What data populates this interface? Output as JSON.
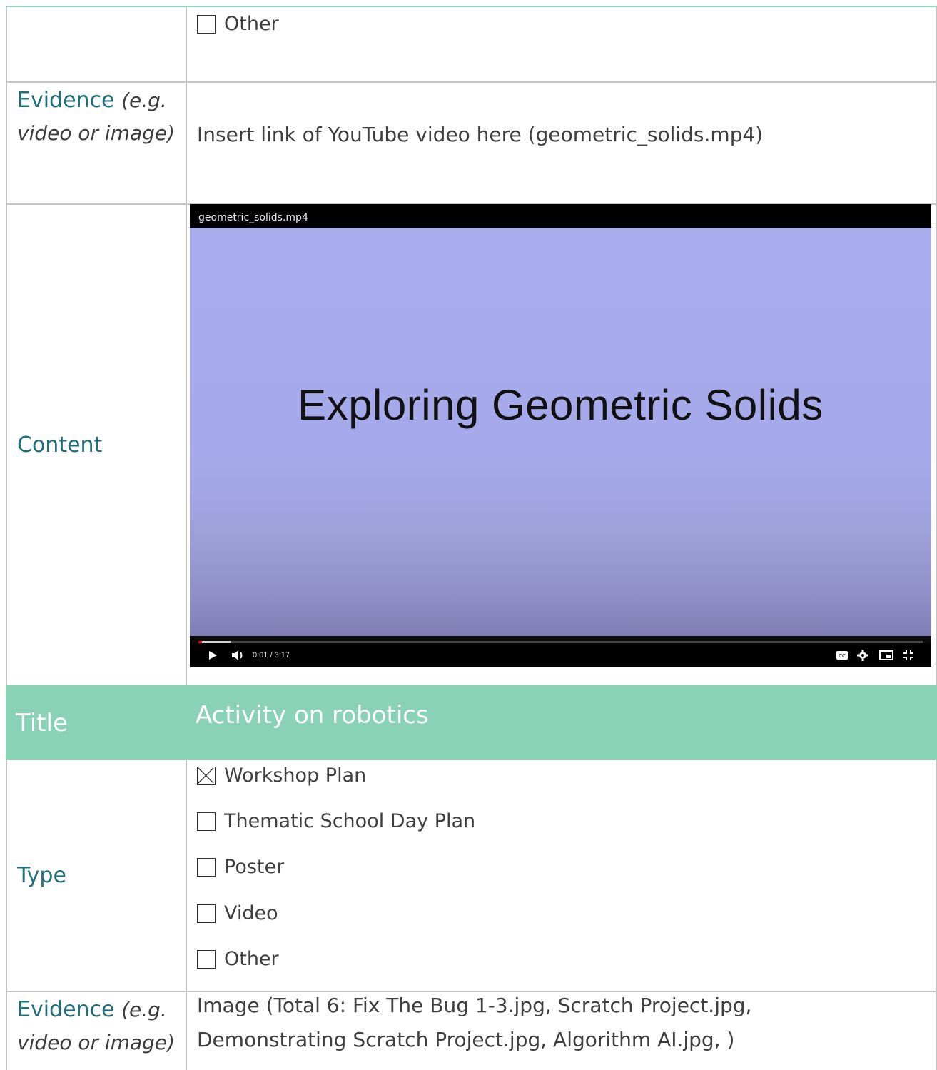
{
  "top_section": {
    "other_option": {
      "label": "Other",
      "checked": false
    }
  },
  "evidence_row_1": {
    "label": "Evidence",
    "hint": "(e.g. video or image)",
    "value": "Insert link of YouTube video here (geometric_solids.mp4)"
  },
  "content_row": {
    "label": "Content",
    "video": {
      "filename": "geometric_solids.mp4",
      "frame_title": "Exploring Geometric Solids",
      "time": "0:01 / 3:17",
      "progress_fraction": 0.005,
      "buffered_fraction": 0.045,
      "icons": [
        "play-icon",
        "volume-icon",
        "captions-icon",
        "settings-icon",
        "miniplayer-icon",
        "exit-fullscreen-icon"
      ]
    }
  },
  "title_row": {
    "label": "Title",
    "value": "Activity on robotics",
    "color": "#8ad2b5"
  },
  "type_row": {
    "label": "Type",
    "options": [
      {
        "label": "Workshop Plan",
        "checked": true
      },
      {
        "label": "Thematic School Day Plan",
        "checked": false
      },
      {
        "label": "Poster",
        "checked": false
      },
      {
        "label": "Video",
        "checked": false
      },
      {
        "label": "Other",
        "checked": false
      }
    ]
  },
  "evidence_row_2": {
    "label": "Evidence",
    "hint": "(e.g. video or image)",
    "value_line1": "Image (Total 6: Fix The Bug 1-3.jpg, Scratch Project.jpg,",
    "value_line2": "Demonstrating Scratch Project.jpg, Algorithm AI.jpg, )"
  },
  "colors": {
    "label_teal": "#1f6f7a",
    "header_green": "#8ad2b5",
    "border_grey": "#c4c4c4"
  }
}
